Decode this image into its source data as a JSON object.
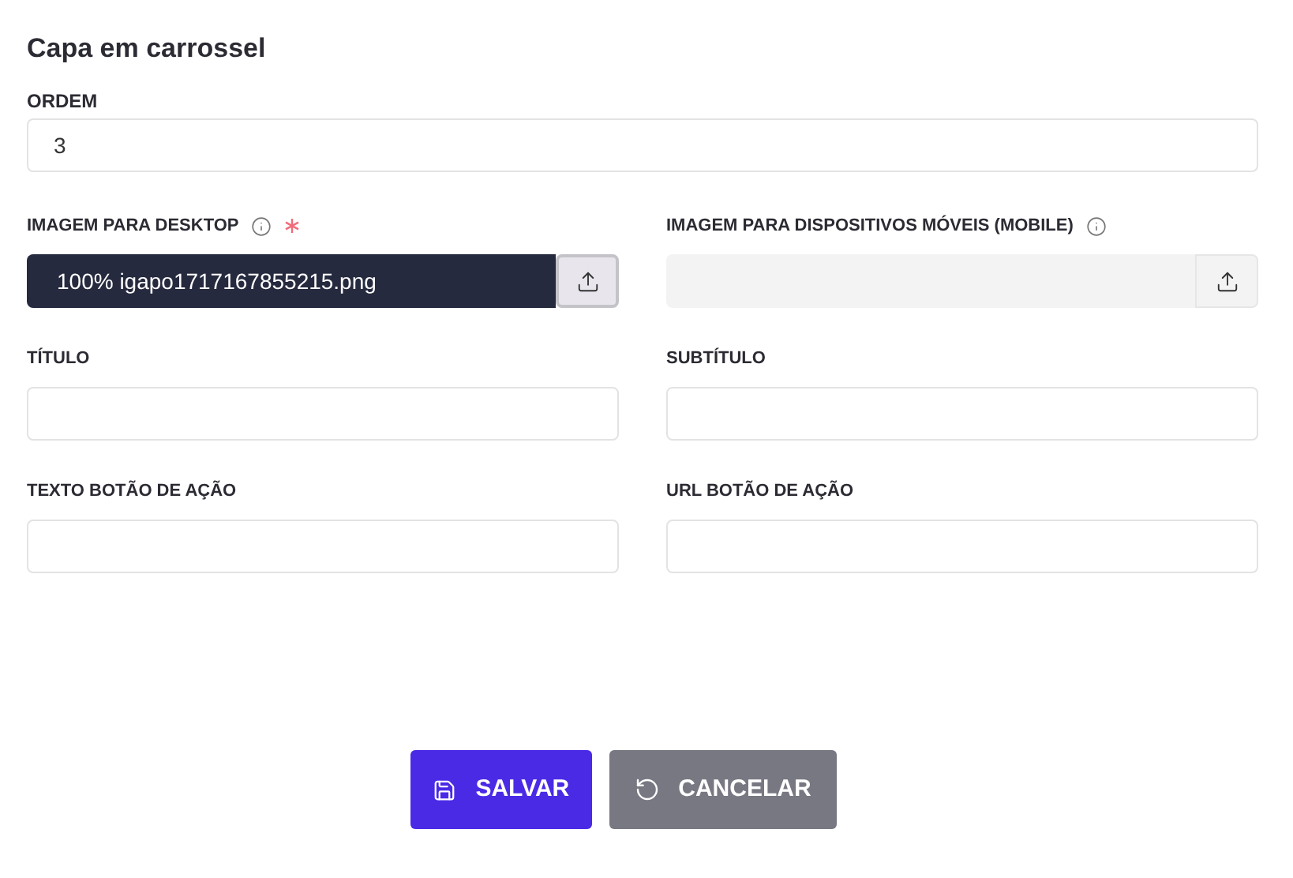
{
  "title": "Capa em carrossel",
  "order": {
    "label": "ORDEM",
    "value": "3"
  },
  "rows": [
    [
      {
        "kind": "upload",
        "label": "IMAGEM PARA DESKTOP",
        "info": true,
        "required": true,
        "value": "100% igapo1717167855215.png",
        "focused": true
      },
      {
        "kind": "upload",
        "label": "IMAGEM PARA DISPOSITIVOS MÓVEIS (MOBILE)",
        "info": true,
        "required": false,
        "focused": false
      }
    ],
    [
      {
        "kind": "text",
        "label": "TÍTULO"
      },
      {
        "kind": "text",
        "label": "SUBTÍTULO"
      }
    ],
    [
      {
        "kind": "text",
        "label": "TEXTO BOTÃO DE AÇÃO"
      },
      {
        "kind": "text",
        "label": "URL BOTÃO DE AÇÃO"
      }
    ]
  ],
  "buttons": [
    {
      "kind": "save",
      "label": "SALVAR"
    },
    {
      "kind": "cancel",
      "label": "CANCELAR"
    }
  ]
}
